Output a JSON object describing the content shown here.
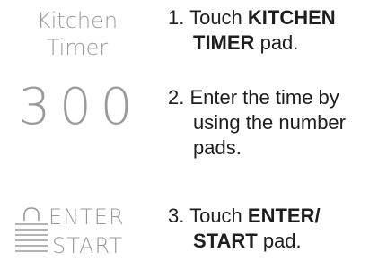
{
  "display": {
    "kitchen_timer_line1": "Kitchen",
    "kitchen_timer_line2": "Timer",
    "digits": "300",
    "enter_label": "ENTER",
    "start_label": "START"
  },
  "steps": [
    {
      "number": "1.",
      "pre": "Touch",
      "bold1": "KITCHEN",
      "bold2": "TIMER",
      "post": "pad."
    },
    {
      "number": "2.",
      "line1": "Enter the time by",
      "line2": "using the number",
      "line3": "pads."
    },
    {
      "number": "3.",
      "pre": "Touch",
      "bold1": "ENTER/",
      "bold2": "START",
      "post": "pad."
    }
  ],
  "colors": {
    "display_gray": "#9a9a9a",
    "text": "#1e1e1e",
    "background": "#ffffff"
  }
}
